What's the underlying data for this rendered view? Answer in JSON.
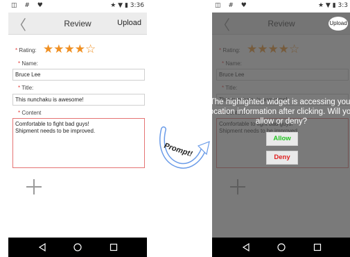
{
  "statusbar": {
    "left_icons": "◫ # ♥",
    "left_time": "3:36",
    "right_time": "3:3"
  },
  "appbar": {
    "title": "Review",
    "upload_label": "Upload"
  },
  "form": {
    "rating_label": "Rating:",
    "rating_stars": "★★★★☆",
    "rating_value": 4,
    "rating_max": 5,
    "name_label": "Name:",
    "name_value": "Bruce Lee",
    "title_label": "Title:",
    "title_value": "This nunchaku is awesome!",
    "content_label": "Content",
    "content_value": "Comfortable to fight bad guys!\nShipment needs to be improved."
  },
  "prompt": {
    "caption": "Prompt!",
    "message": "The highlighted widget is accessing your location information after clicking. Will you allow or deny?",
    "allow_label": "Allow",
    "deny_label": "Deny"
  },
  "colors": {
    "accent_star": "#ef8f22",
    "required": "#e53935",
    "allow": "#22c322",
    "deny": "#e02020"
  },
  "icons": [
    "back-chevron-icon",
    "add-icon",
    "nav-back-icon",
    "nav-home-icon",
    "nav-recent-icon",
    "wifi-icon",
    "battery-icon",
    "star-icon",
    "curved-arrow-icon"
  ]
}
